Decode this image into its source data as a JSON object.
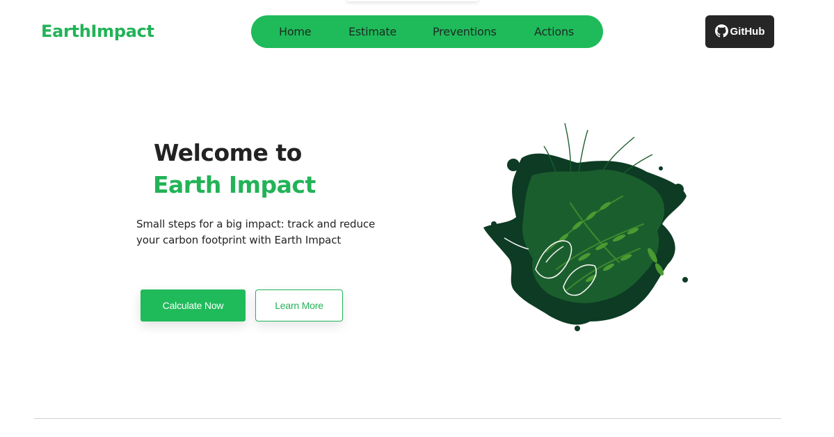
{
  "brand": {
    "name": "EarthImpact"
  },
  "nav": {
    "items": [
      {
        "label": "Home"
      },
      {
        "label": "Estimate"
      },
      {
        "label": "Preventions"
      },
      {
        "label": "Actions"
      }
    ]
  },
  "github": {
    "label": "GitHub",
    "icon": "github-icon"
  },
  "hero": {
    "title_line1": "Welcome to",
    "title_line2": "Earth Impact",
    "tagline": "Small steps for a big impact: track and reduce your carbon footprint with Earth Impact",
    "primary_button": "Calculate Now",
    "secondary_button": "Learn More",
    "image": "leafy-earth-illustration"
  },
  "colors": {
    "brand_green": "#22b357",
    "nav_green": "#1fba5a",
    "dark_text": "#222222",
    "github_bg": "#262626"
  }
}
